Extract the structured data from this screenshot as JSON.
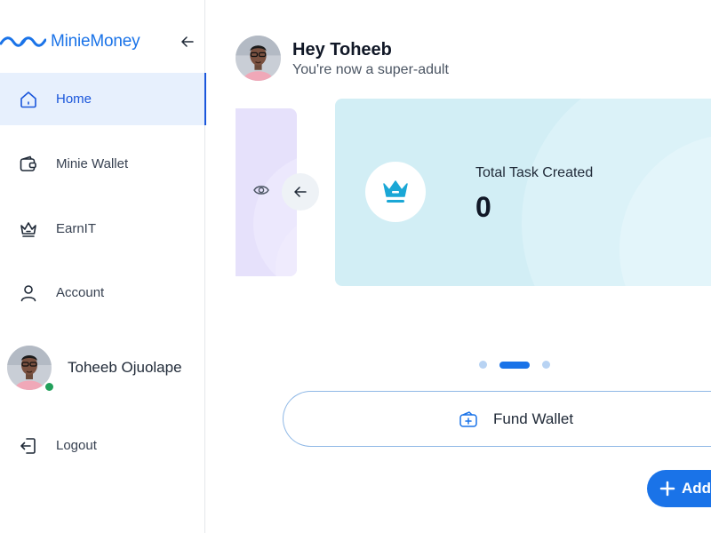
{
  "brand": {
    "name": "MinieMoney",
    "logo_icon": "wave-logo-icon",
    "accent_color": "#1a73e8"
  },
  "sidebar": {
    "collapse_icon": "arrow-left-icon",
    "items": [
      {
        "label": "Home",
        "icon": "home-icon",
        "active": true
      },
      {
        "label": "Minie Wallet",
        "icon": "wallet-icon",
        "active": false
      },
      {
        "label": "EarnIT",
        "icon": "crown-icon",
        "active": false
      },
      {
        "label": "Account",
        "icon": "user-icon",
        "active": false
      }
    ],
    "profile": {
      "name": "Toheeb Ojuolape",
      "status_color": "#22a05b"
    },
    "logout_label": "Logout"
  },
  "main": {
    "greeting": {
      "title": "Hey Toheeb",
      "subtitle": "You're now a super-adult"
    },
    "carousel": {
      "active_index": 1,
      "dot_count": 3,
      "card": {
        "label": "Total Task Created",
        "value": "0",
        "icon": "crown-icon"
      }
    },
    "fund_wallet_label": "Fund Wallet",
    "add_button_label": "Add"
  }
}
